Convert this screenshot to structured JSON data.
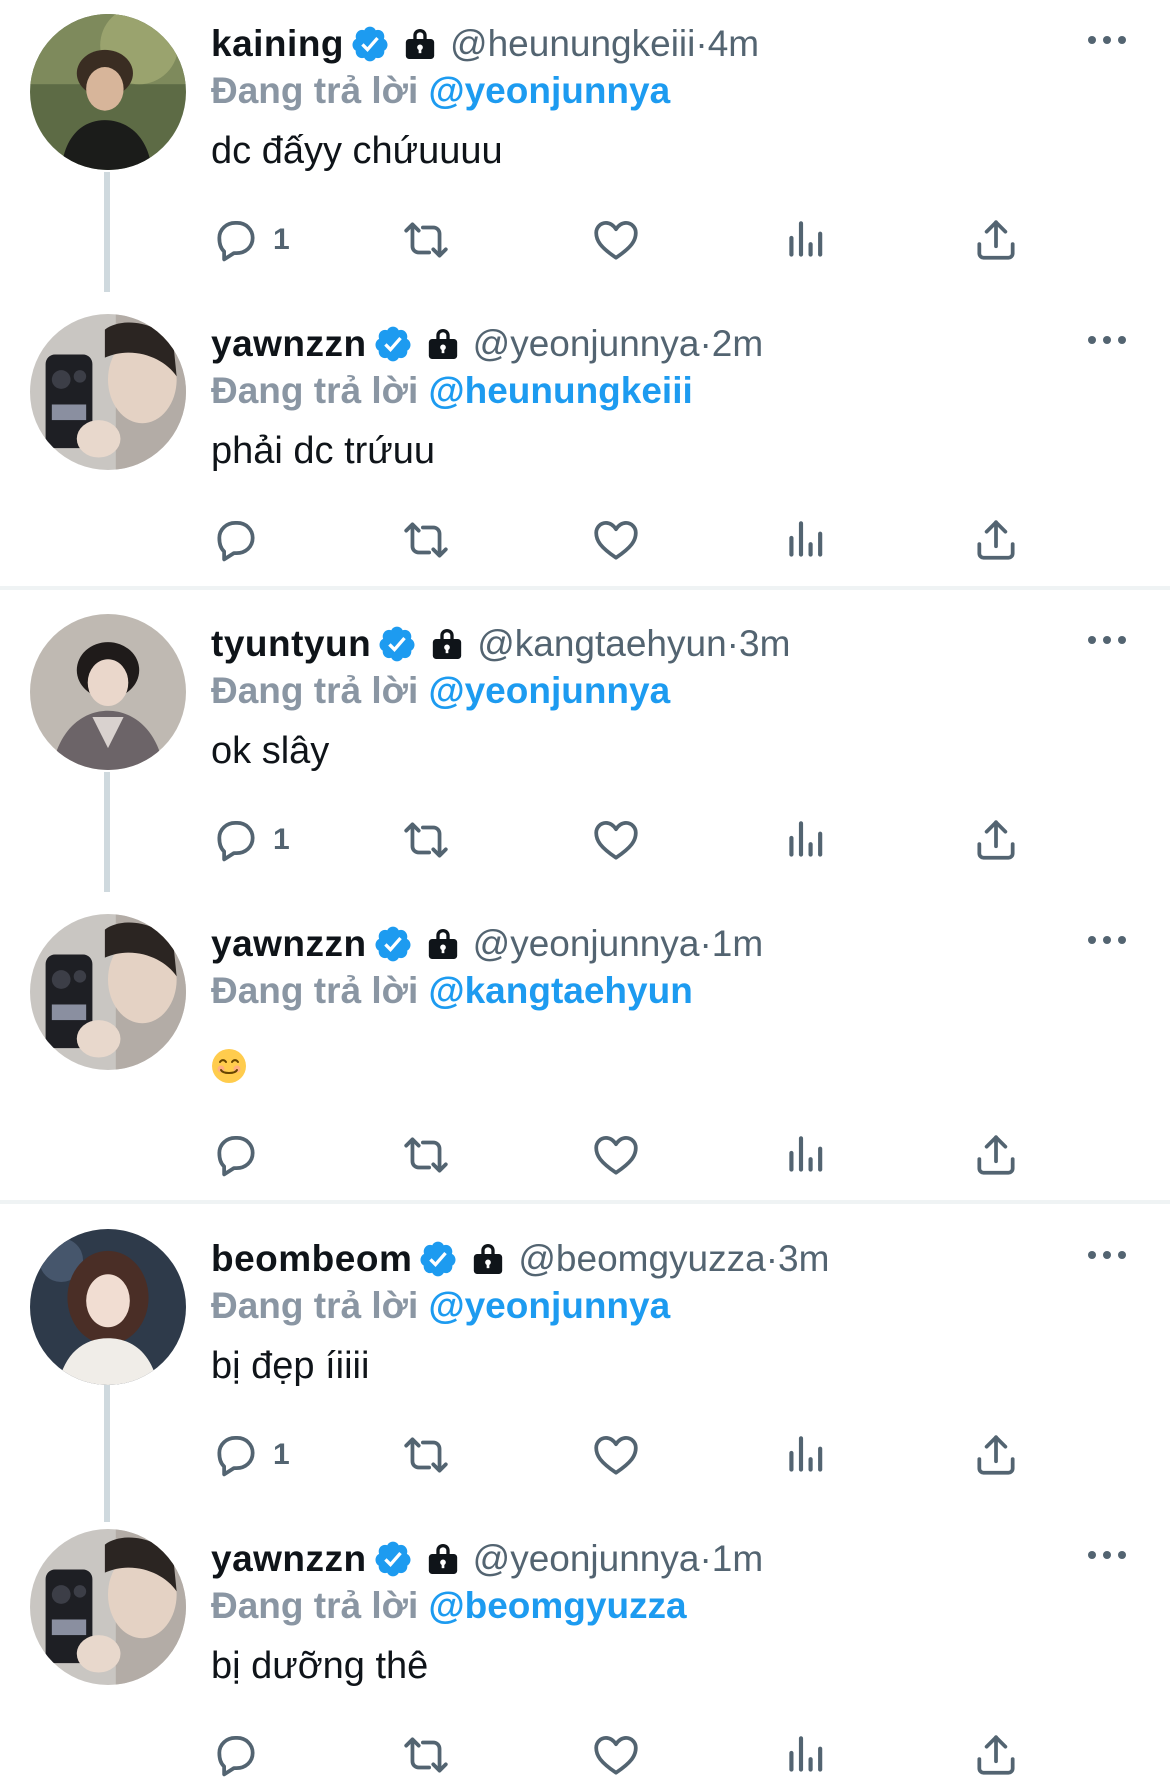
{
  "ui": {
    "handle_separator": " · ",
    "colors": {
      "link": "#1d9bf0",
      "muted": "#536471",
      "replying": "#8a96a3",
      "verified": "#1d9bf0"
    }
  },
  "tweets": [
    {
      "name": "kaining",
      "handle": "@heunungkeiii",
      "time": "4m",
      "replying_label": "Đang trả lời",
      "mention": "@yeonjunnya",
      "text": "dc đấyy chứuuuu",
      "reply_count": "1",
      "avatar_icon": "avatar-kaining"
    },
    {
      "name": "yawnzzn",
      "handle": "@yeonjunnya",
      "time": "2m",
      "replying_label": "Đang trả lời",
      "mention": "@heunungkeiii",
      "text": "phải dc trứuu",
      "reply_count": "",
      "avatar_icon": "avatar-yawnzzn"
    },
    {
      "name": "tyuntyun",
      "handle": "@kangtaehyun",
      "time": "3m",
      "replying_label": "Đang trả lời",
      "mention": "@yeonjunnya",
      "text": "ok slây",
      "reply_count": "1",
      "avatar_icon": "avatar-tyuntyun"
    },
    {
      "name": "yawnzzn",
      "handle": "@yeonjunnya",
      "time": "1m",
      "replying_label": "Đang trả lời",
      "mention": "@kangtaehyun",
      "text": "",
      "reply_count": "",
      "avatar_icon": "avatar-yawnzzn",
      "emoji": "smiling-face-emoji"
    },
    {
      "name": "beombeom",
      "handle": "@beomgyuzza",
      "time": "3m",
      "replying_label": "Đang trả lời",
      "mention": "@yeonjunnya",
      "text": "bị đẹp íiiii",
      "reply_count": "1",
      "avatar_icon": "avatar-beombeom"
    },
    {
      "name": "yawnzzn",
      "handle": "@yeonjunnya",
      "time": "1m",
      "replying_label": "Đang trả lời",
      "mention": "@beomgyuzza",
      "text": "bị dưỡng thê",
      "reply_count": "",
      "avatar_icon": "avatar-yawnzzn"
    }
  ]
}
